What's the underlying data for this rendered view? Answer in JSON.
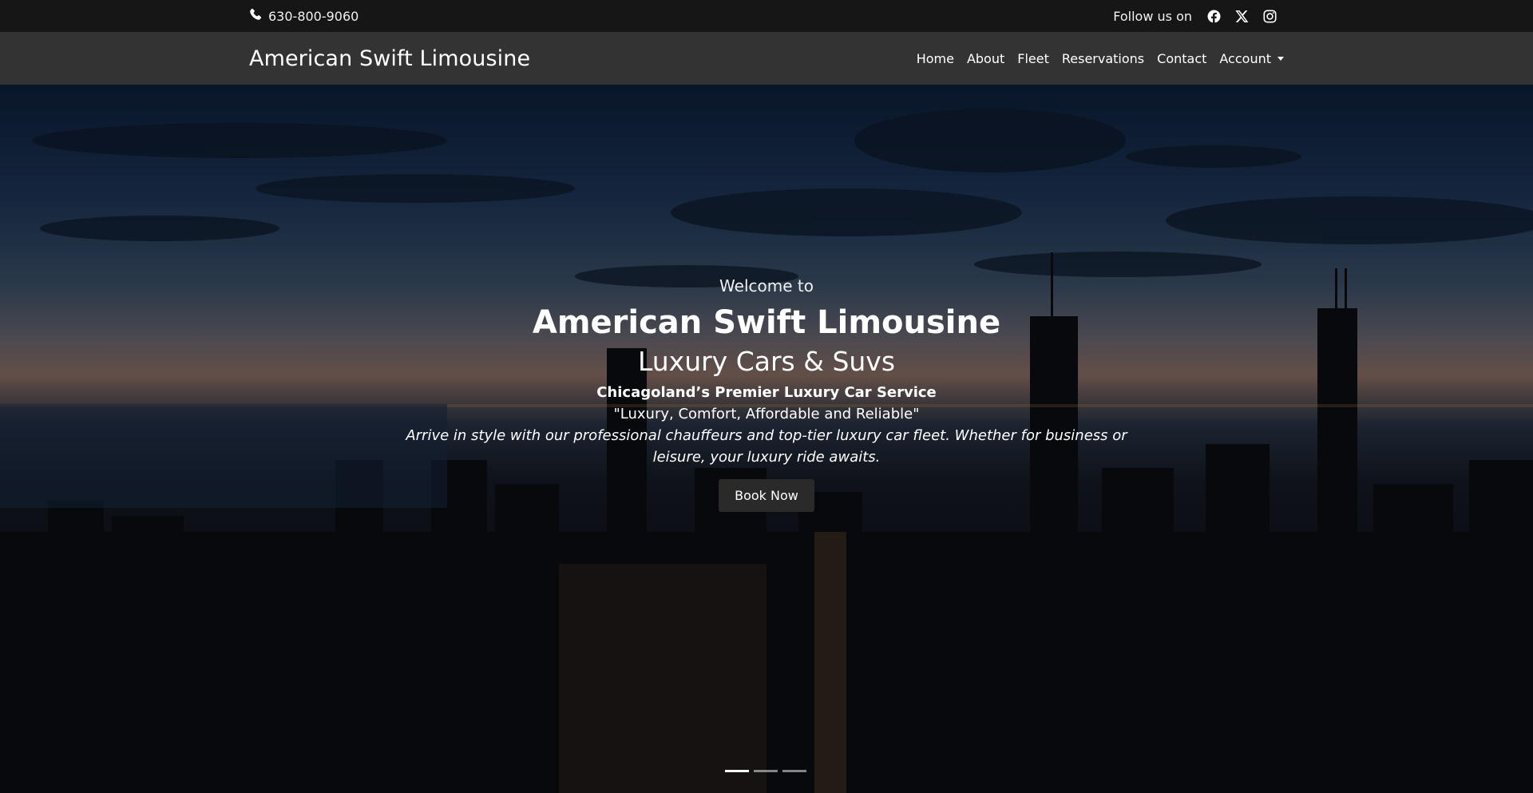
{
  "topbar": {
    "phone": "630-800-9060",
    "follow_label": "Follow us on",
    "social": [
      {
        "name": "facebook-icon"
      },
      {
        "name": "x-icon"
      },
      {
        "name": "instagram-icon"
      }
    ]
  },
  "navbar": {
    "brand": "American Swift Limousine",
    "links": [
      "Home",
      "About",
      "Fleet",
      "Reservations",
      "Contact",
      "Account"
    ]
  },
  "hero": {
    "welcome": "Welcome to",
    "title": "American Swift Limousine",
    "subtitle": "Luxury Cars & Suvs",
    "tagline": "Chicagoland’s Premier Luxury Car Service",
    "quote": "\"Luxury, Comfort, Affordable and Reliable\"",
    "description": "Arrive in style with our professional chauffeurs and top-tier luxury car fleet. Whether for business or leisure, your luxury ride awaits.",
    "button": "Book Now",
    "slides": 3,
    "active_slide": 1
  },
  "colors": {
    "topbar_bg": "#161616",
    "navbar_bg": "#333333",
    "button_bg": "#2a2a2a"
  }
}
